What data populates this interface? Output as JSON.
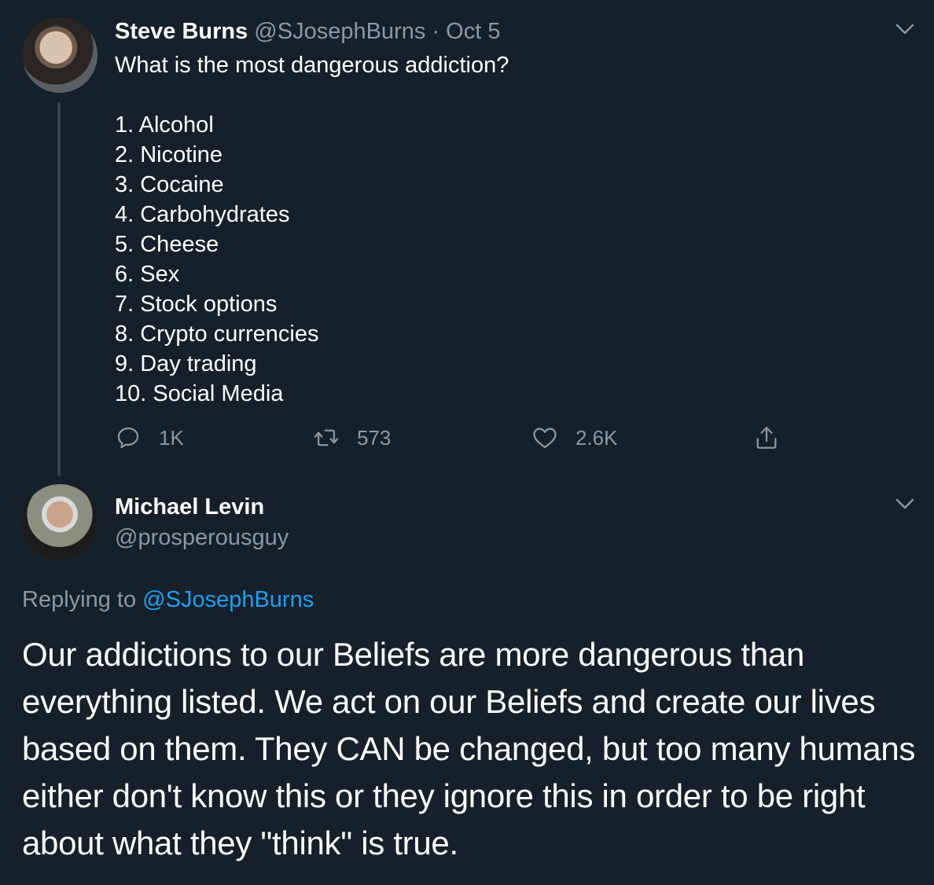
{
  "colors": {
    "background": "#15202b",
    "primary_text": "#ffffff",
    "secondary_text": "#8899a6",
    "link": "#1da1f2",
    "thread_line": "#38444d"
  },
  "tweet1": {
    "display_name": "Steve Burns",
    "handle": "@SJosephBurns",
    "separator": "·",
    "date": "Oct 5",
    "question": "What is the most dangerous addiction?",
    "list": [
      "1. Alcohol",
      "2. Nicotine",
      "3. Cocaine",
      "4. Carbohydrates",
      "5. Cheese",
      "6. Sex",
      "7. Stock options",
      "8. Crypto currencies",
      "9. Day trading",
      "10. Social Media"
    ],
    "actions": {
      "reply_icon": "reply-icon",
      "reply_count": "1K",
      "retweet_icon": "retweet-icon",
      "retweet_count": "573",
      "like_icon": "heart-icon",
      "like_count": "2.6K",
      "share_icon": "share-icon"
    }
  },
  "tweet2": {
    "display_name": "Michael Levin",
    "handle": "@prosperousguy",
    "replying_prefix": "Replying to ",
    "replying_handle": "@SJosephBurns",
    "text": "Our addictions to our Beliefs are more dangerous than everything listed.  We act on our Beliefs and create our lives based on them. They CAN be changed, but too many humans either don't know this or they ignore this in order to be right about what they \"think\" is true."
  }
}
